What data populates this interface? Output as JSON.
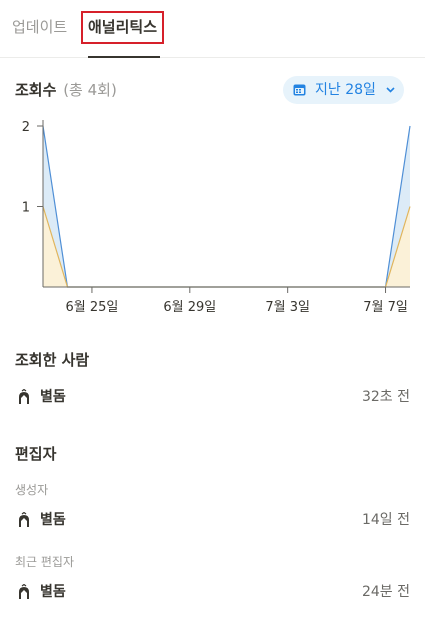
{
  "tabs": {
    "updates": "업데이트",
    "analytics": "애널리틱스"
  },
  "views": {
    "title": "조회수",
    "count": "(총 4회)",
    "range_label": "지난 28일"
  },
  "colors": {
    "accent": "#2383e2",
    "range_bg": "#e7f3fb",
    "series_blue": "#4f8fd6",
    "series_orange": "#e0b55d",
    "highlight_border": "#d6202a"
  },
  "icons": {
    "range": "calendar-icon",
    "range_chevron": "chevron-down-icon",
    "avatar": "star-avatar-icon"
  },
  "chart_data": {
    "type": "area",
    "x_ticks": [
      "6월 25일",
      "6월 29일",
      "7월 3일",
      "7월 7일"
    ],
    "y_ticks": [
      "2",
      "1"
    ],
    "ylim": [
      0,
      2
    ],
    "x": [
      "6월 23일",
      "6월 24일",
      "6월 25일",
      "6월 26일",
      "6월 27일",
      "6월 28일",
      "6월 29일",
      "6월 30일",
      "7월 1일",
      "7월 2일",
      "7월 3일",
      "7월 4일",
      "7월 5일",
      "7월 6일",
      "7월 7일",
      "7월 8일"
    ],
    "series": [
      {
        "values": [
          2,
          0,
          0,
          0,
          0,
          0,
          0,
          0,
          0,
          0,
          0,
          0,
          0,
          0,
          0,
          2
        ]
      },
      {
        "values": [
          1,
          0,
          0,
          0,
          0,
          0,
          0,
          0,
          0,
          0,
          0,
          0,
          0,
          0,
          0,
          1
        ]
      }
    ],
    "grid": false,
    "legend": "none"
  },
  "viewers": {
    "title": "조회한 사람",
    "rows": [
      {
        "name": "별돔",
        "time": "32초 전"
      }
    ]
  },
  "editors": {
    "title": "편집자",
    "creator_label": "생성자",
    "creator": {
      "name": "별돔",
      "time": "14일 전"
    },
    "recent_label": "최근 편집자",
    "recent": {
      "name": "별돔",
      "time": "24분 전"
    }
  }
}
